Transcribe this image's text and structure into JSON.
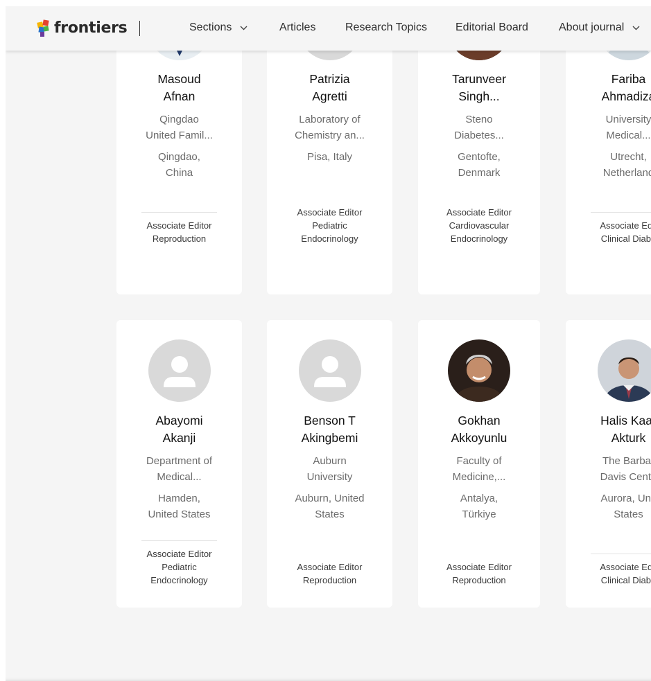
{
  "header": {
    "logo_text": "frontiers",
    "nav": [
      {
        "label": "Sections",
        "has_dropdown": true
      },
      {
        "label": "Articles",
        "has_dropdown": false
      },
      {
        "label": "Research Topics",
        "has_dropdown": false
      },
      {
        "label": "Editorial Board",
        "has_dropdown": false
      },
      {
        "label": "About journal",
        "has_dropdown": true
      }
    ]
  },
  "colors": {
    "page_bg": "#f5f5f5",
    "card_bg": "#ffffff",
    "placeholder_avatar": "#d9d9d9"
  },
  "editors": [
    {
      "name_line1": "Masoud",
      "name_line2": "Afnan",
      "inst_line1": "Qingdao",
      "inst_line2": "United Famil...",
      "loc_line1": "Qingdao,",
      "loc_line2": "China",
      "role": "Associate Editor",
      "section_line1": "Reproduction",
      "section_line2": "",
      "photo": "photo-man-glasses"
    },
    {
      "name_line1": "Patrizia",
      "name_line2": "Agretti",
      "inst_line1": "Laboratory of",
      "inst_line2": "Chemistry an...",
      "loc_line1": "Pisa, Italy",
      "loc_line2": "",
      "role": "Associate Editor",
      "section_line1": "Pediatric",
      "section_line2": "Endocrinology",
      "photo": "placeholder"
    },
    {
      "name_line1": "Tarunveer",
      "name_line2": "Singh...",
      "inst_line1": "Steno",
      "inst_line2": "Diabetes...",
      "loc_line1": "Gentofte,",
      "loc_line2": "Denmark",
      "role": "Associate Editor",
      "section_line1": "Cardiovascular",
      "section_line2": "Endocrinology",
      "photo": "photo-man-beard"
    },
    {
      "name_line1": "Fariba",
      "name_line2": "Ahmadiza",
      "inst_line1": "University",
      "inst_line2": "Medical...",
      "loc_line1": "Utrecht,",
      "loc_line2": "Netherland",
      "role": "Associate Edit",
      "section_line1": "Clinical Diabe",
      "section_line2": "",
      "photo": "photo-woman"
    },
    {
      "name_line1": "Abayomi",
      "name_line2": "Akanji",
      "inst_line1": "Department of",
      "inst_line2": "Medical...",
      "loc_line1": "Hamden,",
      "loc_line2": "United States",
      "role": "Associate Editor",
      "section_line1": "Pediatric",
      "section_line2": "Endocrinology",
      "photo": "placeholder"
    },
    {
      "name_line1": "Benson T",
      "name_line2": "Akingbemi",
      "inst_line1": "Auburn",
      "inst_line2": "University",
      "loc_line1": "Auburn, United",
      "loc_line2": "States",
      "role": "Associate Editor",
      "section_line1": "Reproduction",
      "section_line2": "",
      "photo": "placeholder"
    },
    {
      "name_line1": "Gokhan",
      "name_line2": "Akkoyunlu",
      "inst_line1": "Faculty of",
      "inst_line2": "Medicine,...",
      "loc_line1": "Antalya,",
      "loc_line2": "Türkiye",
      "role": "Associate Editor",
      "section_line1": "Reproduction",
      "section_line2": "",
      "photo": "photo-man-grey"
    },
    {
      "name_line1": "Halis Kaar",
      "name_line2": "Akturk",
      "inst_line1": "The Barbar",
      "inst_line2": "Davis Cente",
      "loc_line1": "Aurora, Unit",
      "loc_line2": "States",
      "role": "Associate Edit",
      "section_line1": "Clinical Diabe",
      "section_line2": "",
      "photo": "photo-man-suit"
    }
  ]
}
